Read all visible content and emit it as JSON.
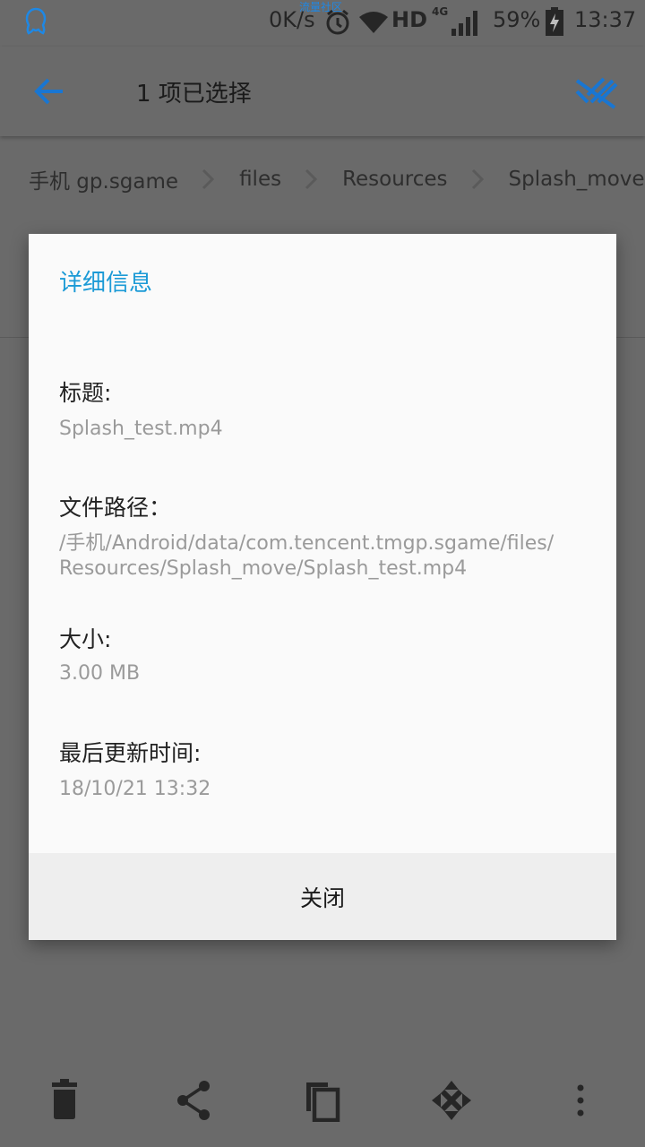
{
  "status_bar": {
    "tiny_label": "流量社区",
    "net_speed": "0K/s",
    "hd": "HD",
    "network_type": "4G",
    "battery_percent": "59%",
    "time": "13:37",
    "accent_color": "#1e88e5"
  },
  "toolbar": {
    "title": "1 项已选择",
    "icons": [
      "arrow-left-icon",
      "deselect-all-icon"
    ],
    "accent_color": "#1976d2"
  },
  "breadcrumb": {
    "items": [
      "手机 gp.sgame",
      "files",
      "Resources",
      "Splash_move"
    ]
  },
  "dialog": {
    "title": "详细信息",
    "title_color": "#1b9ad6",
    "fields": [
      {
        "label": "标题:",
        "value": "Splash_test.mp4"
      },
      {
        "label": "文件路径：",
        "value_lines": [
          "/手机/Android/data/com.tencent.tmgp.sgame/files/",
          "Resources/Splash_move/Splash_test.mp4"
        ]
      },
      {
        "label": "大小:",
        "value": "3.00 MB"
      },
      {
        "label": "最后更新时间:",
        "value": "18/10/21 13:32"
      }
    ],
    "close_label": "关闭"
  },
  "bottom_bar": {
    "icons": [
      "delete-icon",
      "share-icon",
      "copy-icon",
      "move-icon",
      "more-vertical-icon"
    ]
  }
}
